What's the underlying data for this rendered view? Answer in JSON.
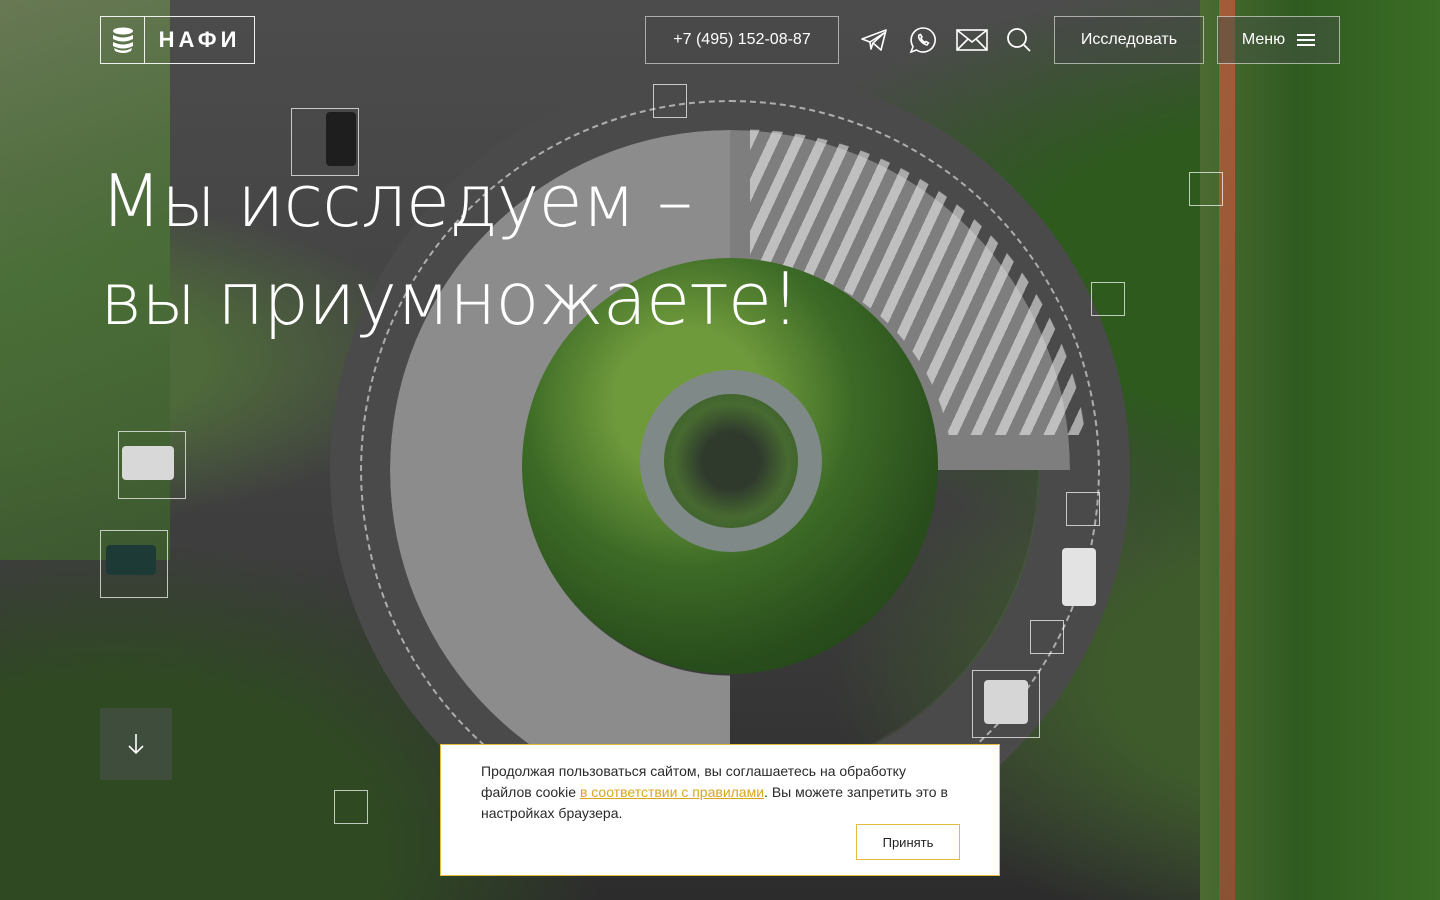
{
  "brand": {
    "name": "НАФИ"
  },
  "header": {
    "phone": "+7 (495) 152-08-87",
    "icons": [
      "telegram-icon",
      "whatsapp-icon",
      "mail-icon",
      "search-icon"
    ],
    "explore_label": "Исследовать",
    "menu_label": "Меню"
  },
  "hero": {
    "line1": "Мы исследуем –",
    "line2": "вы приумножаете!"
  },
  "cookie": {
    "text_before": "Продолжая пользоваться сайтом, вы соглашаетесь на обработку файлов cookie ",
    "link_text": "в соответствии с правилами",
    "text_after": ". Вы можете запретить это в настройках браузера.",
    "accept_label": "Принять"
  },
  "colors": {
    "accent": "#e2bc3e",
    "link": "#d9a520"
  }
}
